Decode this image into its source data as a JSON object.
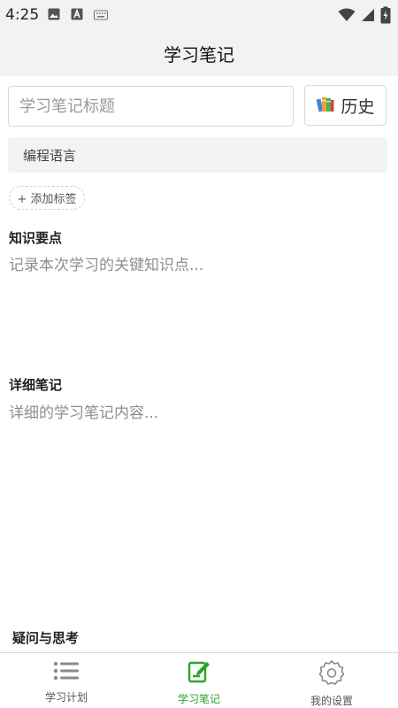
{
  "status_bar": {
    "time": "4:25",
    "icons": [
      "image-icon",
      "a-notification-icon",
      "keyboard-icon",
      "wifi-icon",
      "signal-icon",
      "battery-charging-icon"
    ]
  },
  "app_bar": {
    "title": "学习笔记"
  },
  "form": {
    "title_placeholder": "学习笔记标题",
    "title_value": "",
    "history_button": {
      "icon": "books-icon",
      "label": "历史"
    },
    "language_select": "编程语言",
    "add_tag_button": "+ 添加标签"
  },
  "sections": {
    "key_points": {
      "label": "知识要点",
      "placeholder": "记录本次学习的关键知识点..."
    },
    "detailed_notes": {
      "label": "详细笔记",
      "placeholder": "详细的学习笔记内容..."
    },
    "questions": {
      "label": "疑问与思考"
    }
  },
  "tab_bar": {
    "active_color": "#2aa52a",
    "items": [
      {
        "label": "学习计划",
        "icon": "list-icon",
        "active": false
      },
      {
        "label": "学习笔记",
        "icon": "edit-note-icon",
        "active": true
      },
      {
        "label": "我的设置",
        "icon": "gear-icon",
        "active": false
      }
    ]
  }
}
